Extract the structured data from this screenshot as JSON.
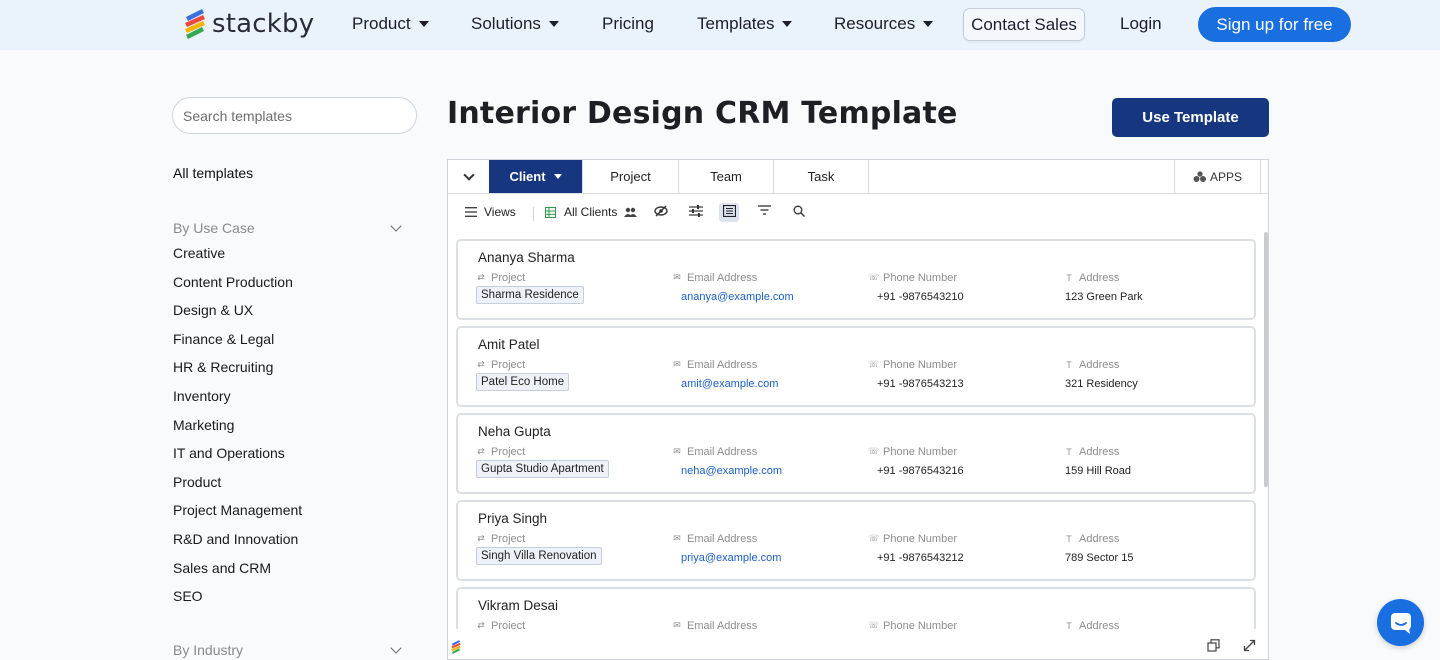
{
  "brand": {
    "name": "stackby",
    "logo_icon": "stackby-logo-icon"
  },
  "nav": {
    "items": [
      {
        "label": "Product",
        "dropdown": true
      },
      {
        "label": "Solutions",
        "dropdown": true
      },
      {
        "label": "Pricing",
        "dropdown": false
      },
      {
        "label": "Templates",
        "dropdown": true
      },
      {
        "label": "Resources",
        "dropdown": true
      }
    ],
    "contact_sales": "Contact Sales",
    "login": "Login",
    "signup": "Sign up for free"
  },
  "sidebar": {
    "search_placeholder": "Search templates",
    "all_templates": "All templates",
    "use_case_heading": "By Use Case",
    "use_cases": [
      "Creative",
      "Content Production",
      "Design & UX",
      "Finance & Legal",
      "HR & Recruiting",
      "Inventory",
      "Marketing",
      "IT and Operations",
      "Product",
      "Project Management",
      "R&D and Innovation",
      "Sales and CRM",
      "SEO"
    ],
    "industry_heading": "By Industry"
  },
  "main": {
    "title": "Interior Design CRM Template",
    "use_template": "Use Template"
  },
  "embed": {
    "tabs": [
      {
        "label": "Client",
        "active": true
      },
      {
        "label": "Project",
        "active": false
      },
      {
        "label": "Team",
        "active": false
      },
      {
        "label": "Task",
        "active": false
      }
    ],
    "apps_label": "APPS",
    "toolbar": {
      "views_label": "Views",
      "view_name": "All Clients"
    },
    "field_labels": {
      "project": "Project",
      "email": "Email Address",
      "phone": "Phone Number",
      "address": "Address"
    },
    "records": [
      {
        "name": "Ananya Sharma",
        "project": "Sharma Residence",
        "email": "ananya@example.com",
        "phone": "+91 -9876543210",
        "address": "123 Green Park"
      },
      {
        "name": "Amit Patel",
        "project": "Patel Eco Home",
        "email": "amit@example.com",
        "phone": "+91 -9876543213",
        "address": "321 Residency"
      },
      {
        "name": "Neha Gupta",
        "project": "Gupta Studio Apartment",
        "email": "neha@example.com",
        "phone": "+91 -9876543216",
        "address": "159 Hill Road"
      },
      {
        "name": "Priya Singh",
        "project": "Singh Villa Renovation",
        "email": "priya@example.com",
        "phone": "+91 -9876543212",
        "address": "789 Sector 15"
      },
      {
        "name": "Vikram Desai",
        "project": "",
        "email": "",
        "phone": "",
        "address": ""
      }
    ]
  },
  "colors": {
    "accent": "#16377f",
    "signup": "#1a6fe0",
    "link": "#1a5fc6",
    "nav_bg": "#eaf3fb"
  }
}
